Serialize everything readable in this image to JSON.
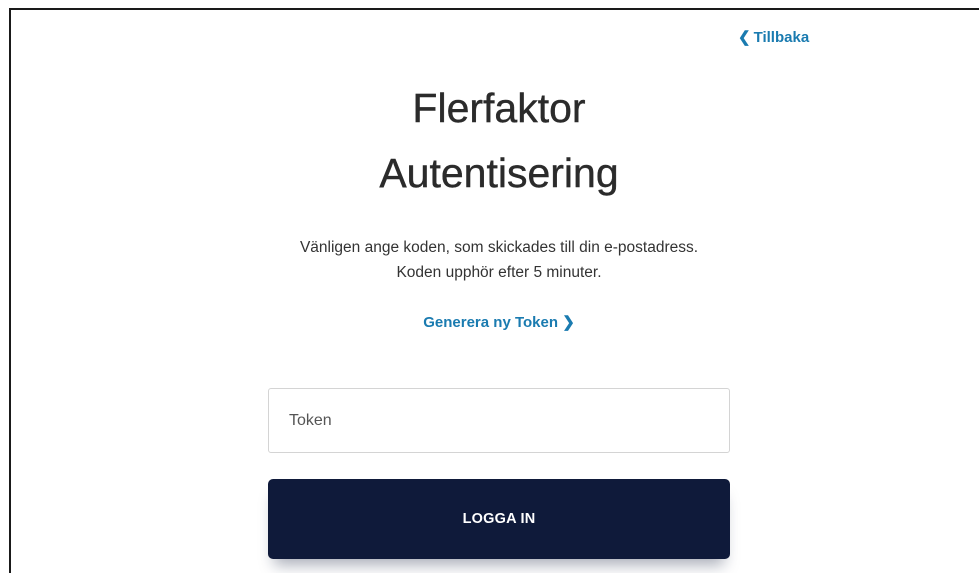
{
  "header": {
    "back_label": "Tillbaka"
  },
  "title": {
    "line1": "Flerfaktor",
    "line2": "Autentisering"
  },
  "instructions": {
    "line1": "Vänligen ange koden, som skickades till din e-postadress.",
    "line2": "Koden upphör efter 5 minuter."
  },
  "regenerate": {
    "label": "Generera ny Token"
  },
  "form": {
    "token_placeholder": "Token",
    "token_value": "",
    "submit_label": "LOGGA IN"
  },
  "colors": {
    "link": "#1a7bb0",
    "button": "#0f1a3a",
    "title": "#2b2b2b"
  },
  "icons": {
    "back": "chevron-left-icon",
    "forward": "chevron-right-icon"
  }
}
